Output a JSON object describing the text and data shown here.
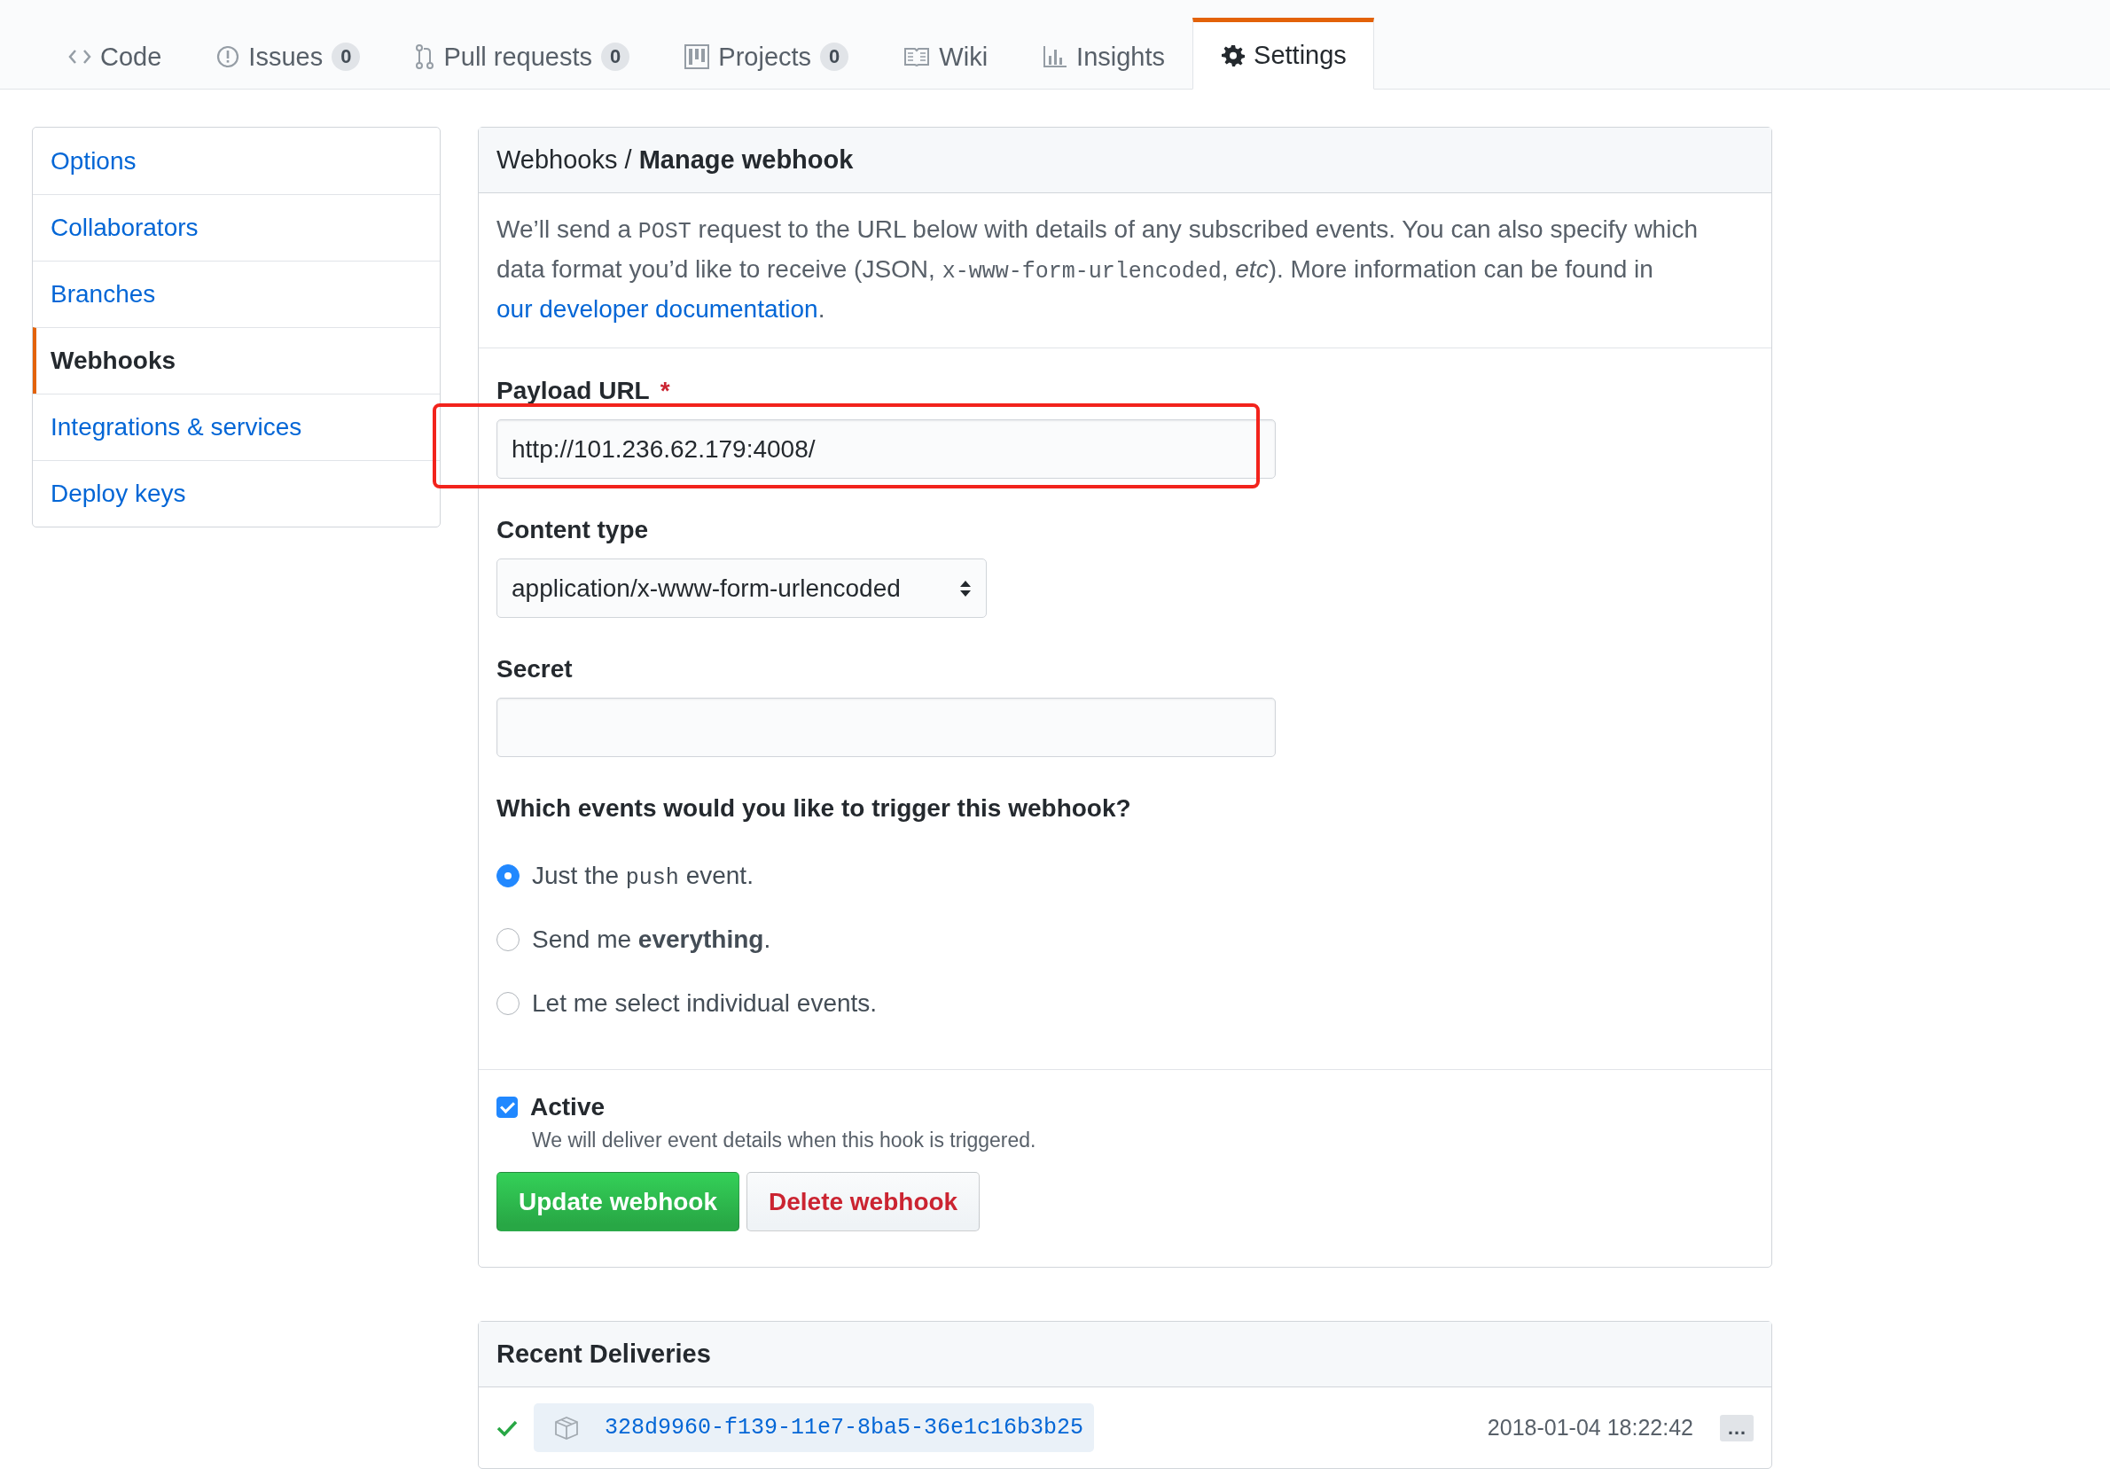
{
  "tabs": [
    {
      "label": "Code",
      "selected": false
    },
    {
      "label": "Issues",
      "count": "0",
      "selected": false
    },
    {
      "label": "Pull requests",
      "count": "0",
      "selected": false
    },
    {
      "label": "Projects",
      "count": "0",
      "selected": false
    },
    {
      "label": "Wiki",
      "selected": false
    },
    {
      "label": "Insights",
      "selected": false
    },
    {
      "label": "Settings",
      "selected": true
    }
  ],
  "sidebar": {
    "items": [
      {
        "label": "Options",
        "selected": false
      },
      {
        "label": "Collaborators",
        "selected": false
      },
      {
        "label": "Branches",
        "selected": false
      },
      {
        "label": "Webhooks",
        "selected": true
      },
      {
        "label": "Integrations & services",
        "selected": false
      },
      {
        "label": "Deploy keys",
        "selected": false
      }
    ]
  },
  "webhook": {
    "heading": "Webhooks / **Manage webhook**",
    "description": [
      {
        "kind": "text",
        "text": "We’ll send a "
      },
      {
        "kind": "code",
        "text": "POST"
      },
      {
        "kind": "text",
        "text": " request to the URL below with details of any subscribed events. You can also specify which data format you’d like to receive (JSON, "
      },
      {
        "kind": "code",
        "text": "x-www-form-urlencoded"
      },
      {
        "kind": "text",
        "text": ", "
      },
      {
        "kind": "italic",
        "text": "etc"
      },
      {
        "kind": "text",
        "text": "). More information can be found in "
      },
      {
        "kind": "link",
        "text": "our developer documentation"
      },
      {
        "kind": "text",
        "text": "."
      }
    ],
    "payload_url": {
      "label": "Payload URL",
      "required_mark": "*",
      "value": "http://101.236.62.179:4008/"
    },
    "content_type": {
      "label": "Content type",
      "value": "application/x-www-form-urlencoded"
    },
    "secret": {
      "label": "Secret"
    },
    "events": {
      "question": "Which events would you like to trigger this webhook?",
      "options": [
        {
          "selected": true,
          "segments": [
            {
              "kind": "text",
              "text": "Just the "
            },
            {
              "kind": "code",
              "text": "push"
            },
            {
              "kind": "text",
              "text": " event."
            }
          ]
        },
        {
          "selected": false,
          "segments": [
            {
              "kind": "text",
              "text": "Send me "
            },
            {
              "kind": "bold",
              "text": "everything"
            },
            {
              "kind": "text",
              "text": "."
            }
          ]
        },
        {
          "selected": false,
          "segments": [
            {
              "kind": "text",
              "text": "Let me select individual events."
            }
          ]
        }
      ]
    },
    "active": {
      "label": "Active",
      "checked": true,
      "note": "We will deliver event details when this hook is triggered."
    },
    "buttons": [
      {
        "kind": "primary",
        "label": "Update webhook"
      },
      {
        "kind": "danger",
        "label": "Delete webhook"
      }
    ]
  },
  "recent_deliveries": {
    "title": "Recent Deliveries",
    "rows": [
      {
        "id": "328d9960-f139-11e7-8ba5-36e1c16b3b25",
        "time": "2018-01-04 18:22:42",
        "more": "…"
      }
    ]
  }
}
